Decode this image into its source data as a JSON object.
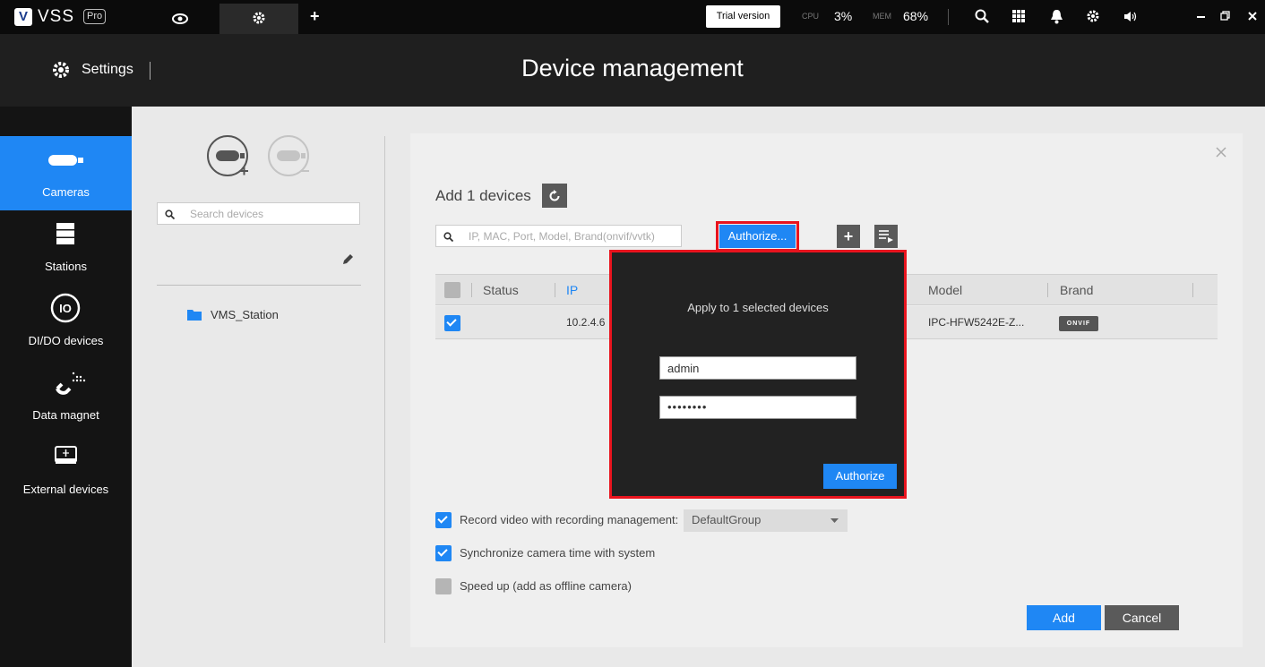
{
  "app": {
    "name": "VSS",
    "badge": "Pro",
    "logo_letter": "V"
  },
  "topbar": {
    "trial_label": "Trial version",
    "cpu_label": "CPU",
    "cpu_value": "3%",
    "mem_label": "MEM",
    "mem_value": "68%"
  },
  "header": {
    "settings_label": "Settings",
    "title": "Device management"
  },
  "sidebar": {
    "items": [
      {
        "label": "Cameras",
        "icon": "camera-icon"
      },
      {
        "label": "Stations",
        "icon": "server-icon"
      },
      {
        "label": "DI/DO devices",
        "icon": "io-icon"
      },
      {
        "label": "Data magnet",
        "icon": "magnet-icon"
      },
      {
        "label": "External devices",
        "icon": "usb-device-icon"
      }
    ]
  },
  "tree": {
    "search_placeholder": "Search devices",
    "station_name": "VMS_Station"
  },
  "add_panel": {
    "title": "Add 1 devices",
    "filter_placeholder": "IP, MAC, Port, Model, Brand(onvif/vvtk)",
    "authorize_label": "Authorize...",
    "columns": [
      "Status",
      "IP",
      "Model",
      "Brand"
    ],
    "rows": [
      {
        "status": "",
        "ip": "10.2.4.6",
        "model": "IPC-HFW5242E-Z...",
        "brand": "ONVIF"
      }
    ],
    "options": [
      {
        "label": "Record video with recording management:",
        "checked": true
      },
      {
        "label": "Synchronize camera time with system",
        "checked": true
      },
      {
        "label": "Speed up (add as offline camera)",
        "checked": false
      }
    ],
    "recording_group": "DefaultGroup",
    "add_label": "Add",
    "cancel_label": "Cancel"
  },
  "auth_dialog": {
    "message": "Apply to 1 selected devices",
    "username": "admin",
    "password": "••••••••",
    "authorize_label": "Authorize"
  },
  "colors": {
    "accent": "#1f87f4",
    "highlight_border": "#e8141e"
  }
}
